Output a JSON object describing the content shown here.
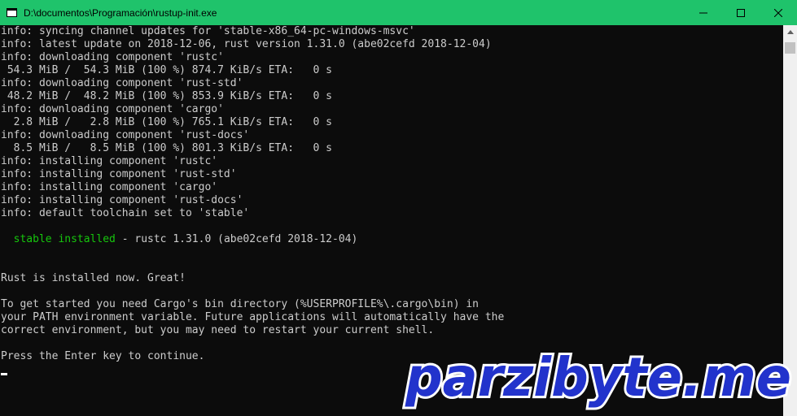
{
  "window": {
    "title": "D:\\documentos\\Programación\\rustup-init.exe",
    "accent": "#1fc36b",
    "buttons": [
      "minimize-icon",
      "maximize-icon",
      "close-icon"
    ]
  },
  "terminal": {
    "background": "#0c0c0c",
    "foreground": "#cccccc",
    "highlight": "#16c60c",
    "lines": [
      {
        "row": 0,
        "text": "info: syncing channel updates for 'stable-x86_64-pc-windows-msvc'"
      },
      {
        "row": 1,
        "text": "info: latest update on 2018-12-06, rust version 1.31.0 (abe02cefd 2018-12-04)"
      },
      {
        "row": 2,
        "text": "info: downloading component 'rustc'"
      },
      {
        "row": 3,
        "text": " 54.3 MiB /  54.3 MiB (100 %) 874.7 KiB/s ETA:   0 s"
      },
      {
        "row": 4,
        "text": "info: downloading component 'rust-std'"
      },
      {
        "row": 5,
        "text": " 48.2 MiB /  48.2 MiB (100 %) 853.9 KiB/s ETA:   0 s"
      },
      {
        "row": 6,
        "text": "info: downloading component 'cargo'"
      },
      {
        "row": 7,
        "text": "  2.8 MiB /   2.8 MiB (100 %) 765.1 KiB/s ETA:   0 s"
      },
      {
        "row": 8,
        "text": "info: downloading component 'rust-docs'"
      },
      {
        "row": 9,
        "text": "  8.5 MiB /   8.5 MiB (100 %) 801.3 KiB/s ETA:   0 s"
      },
      {
        "row": 10,
        "text": "info: installing component 'rustc'"
      },
      {
        "row": 11,
        "text": "info: installing component 'rust-std'"
      },
      {
        "row": 12,
        "text": "info: installing component 'cargo'"
      },
      {
        "row": 13,
        "text": "info: installing component 'rust-docs'"
      },
      {
        "row": 14,
        "text": "info: default toolchain set to 'stable'"
      },
      {
        "row": 19,
        "text": "Rust is installed now. Great!"
      },
      {
        "row": 21,
        "text": "To get started you need Cargo's bin directory (%USERPROFILE%\\.cargo\\bin) in"
      },
      {
        "row": 22,
        "text": "your PATH environment variable. Future applications will automatically have the"
      },
      {
        "row": 23,
        "text": "correct environment, but you may need to restart your current shell."
      },
      {
        "row": 25,
        "text": "Press the Enter key to continue."
      }
    ],
    "install_summary": {
      "toolchain": "stable installed",
      "rest": " - rustc 1.31.0 (abe02cefd 2018-12-04)"
    }
  },
  "watermark": {
    "text": "parzibyte.me",
    "fill": "#2233cc",
    "stroke": "#ffffff"
  }
}
